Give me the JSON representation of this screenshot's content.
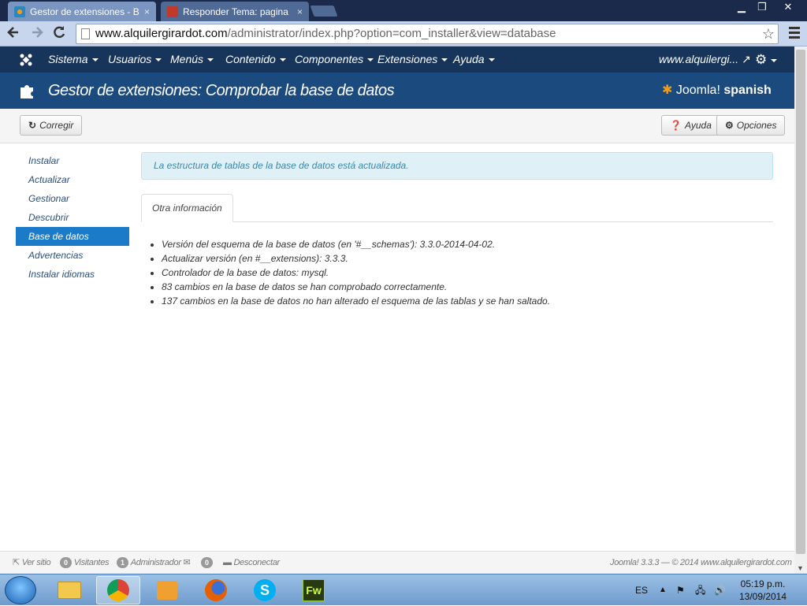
{
  "browser": {
    "tabs": [
      {
        "title": "Gestor de extensiones - Ba",
        "close": "×"
      },
      {
        "title": "Responder Tema: pagina",
        "close": "×"
      }
    ],
    "window_controls": {
      "minimize": "▁",
      "restore": "❐",
      "close": "✕"
    },
    "url_host": "www.alquilergirardot.com",
    "url_path": "/administrator/index.php?option=com_installer&view=database",
    "star": "☆"
  },
  "joomla_nav": {
    "items": [
      "Sistema",
      "Usuarios",
      "Menús",
      "Contenido",
      "Componentes",
      "Extensiones",
      "Ayuda"
    ],
    "site_link": "www.alquilergi...",
    "settings_icon": "⚙"
  },
  "header": {
    "title": "Gestor de extensiones: Comprobar la base de datos",
    "logo_text": "Joomla!",
    "logo_lang": "spanish"
  },
  "actions": {
    "fix": "Corregir",
    "help": "Ayuda",
    "options": "Opciones"
  },
  "sidebar": {
    "items": [
      "Instalar",
      "Actualizar",
      "Gestionar",
      "Descubrir",
      "Base de datos",
      "Advertencias",
      "Instalar idiomas"
    ],
    "active_index": 4
  },
  "alert": "La estructura de tablas de la base de datos está actualizada.",
  "tab_label": "Otra información",
  "info_items": [
    "Versión del esquema de la base de datos (en '#__schemas'): 3.3.0-2014-04-02.",
    "Actualizar versión (en #__extensions): 3.3.3.",
    "Controlador de la base de datos: mysql.",
    "83 cambios en la base de datos se han comprobado correctamente.",
    "137 cambios en la base de datos no han alterado el esquema de las tablas y se han saltado."
  ],
  "status_bar": {
    "view_site": "Ver sitio",
    "visitors_count": "0",
    "visitors": "Visitantes",
    "admin_count": "1",
    "admin": "Administrador",
    "messages_count": "0",
    "logout": "Desconectar",
    "footer": "Joomla! 3.3.3 — © 2014 www.alquilergirardot.com"
  },
  "taskbar": {
    "lang": "ES",
    "time": "05:19 p.m.",
    "date": "13/09/2014",
    "fw_label": "Fw"
  },
  "colors": {
    "nav_bg": "#17345a",
    "header_bg": "#1b4a7e",
    "active_item": "#1c7bc8",
    "alert_bg": "#dff0f7",
    "alert_text": "#3a87ad"
  }
}
